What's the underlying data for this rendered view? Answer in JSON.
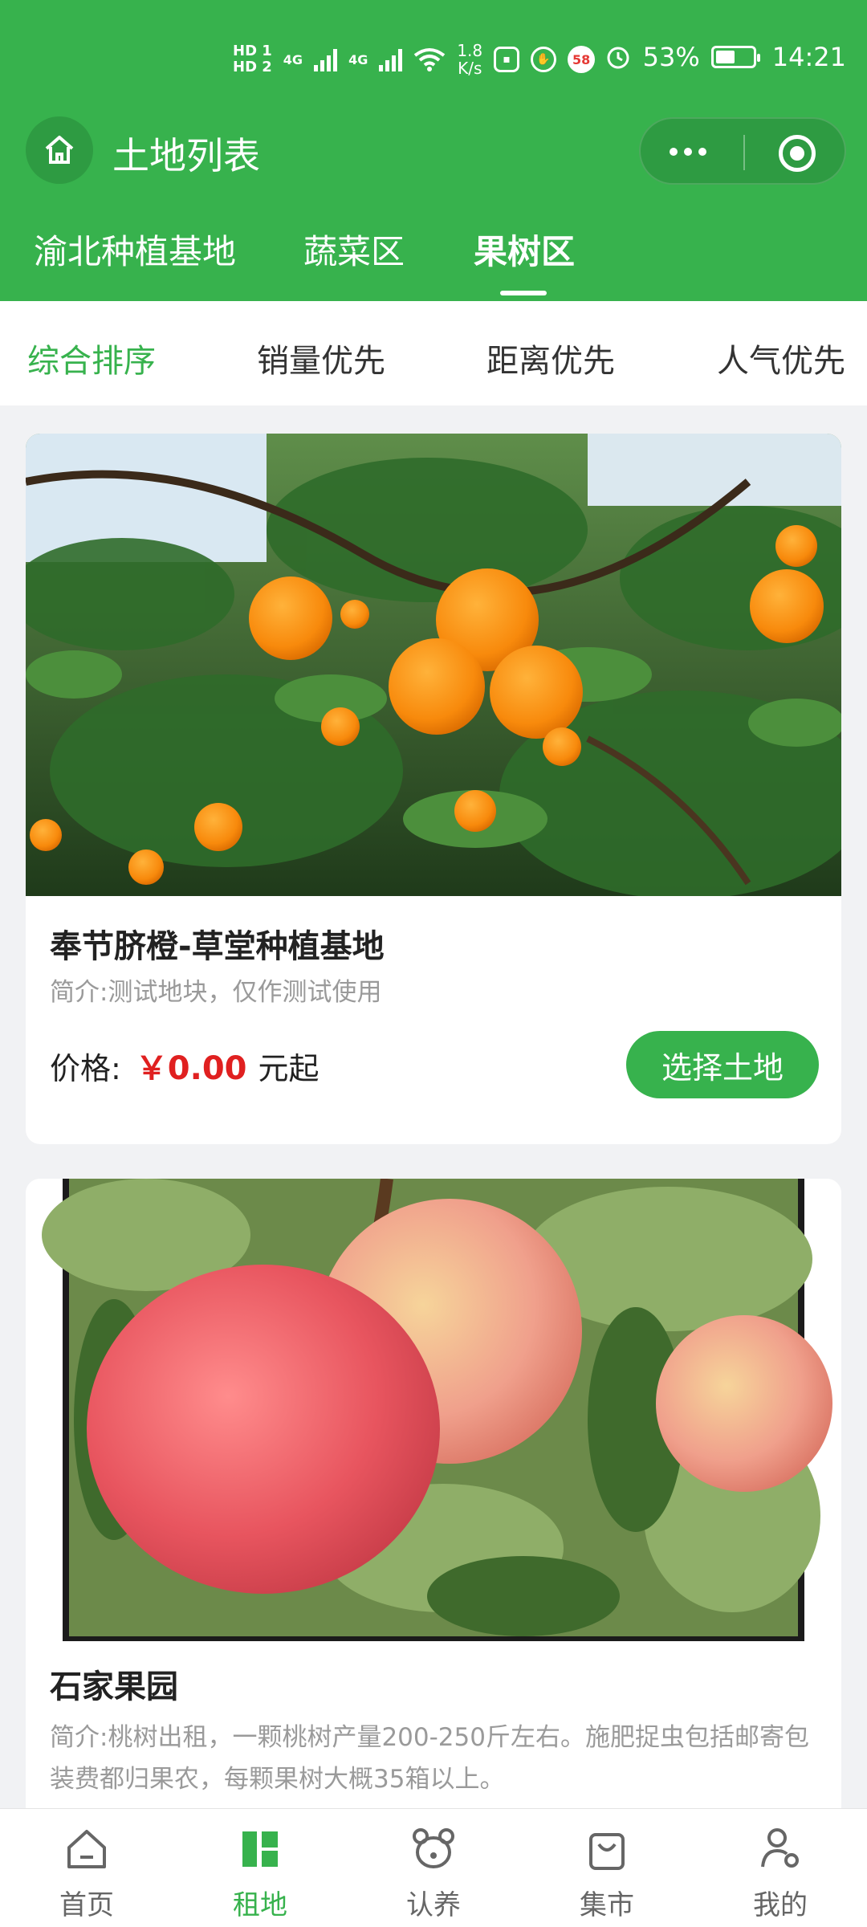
{
  "status_bar": {
    "hd1": "HD 1",
    "hd2": "HD 2",
    "net1": "4G",
    "net2": "4G",
    "speed_value": "1.8",
    "speed_unit": "K/s",
    "badge": "58",
    "battery": "53%",
    "battery_level": 0.53,
    "time": "14:21"
  },
  "navbar": {
    "title": "土地列表"
  },
  "tabs": [
    {
      "label": "渝北种植基地",
      "active": false
    },
    {
      "label": "蔬菜区",
      "active": false
    },
    {
      "label": "果树区",
      "active": true
    }
  ],
  "sort_options": [
    {
      "label": "综合排序",
      "active": true
    },
    {
      "label": "销量优先",
      "active": false
    },
    {
      "label": "距离优先",
      "active": false
    },
    {
      "label": "人气优先",
      "active": false
    }
  ],
  "cards": [
    {
      "title": "奉节脐橙-草堂种植基地",
      "desc": "简介:测试地块，仅作测试使用",
      "price_label": "价格:",
      "price": "￥0.00",
      "price_suffix": "元起",
      "button": "选择土地"
    },
    {
      "title": "石家果园",
      "desc": "简介:桃树出租，一颗桃树产量200-250斤左右。施肥捉虫包括邮寄包装费都归果农，每颗果树大概35箱以上。"
    }
  ],
  "tabbar": [
    {
      "label": "首页",
      "icon": "home-icon",
      "active": false
    },
    {
      "label": "租地",
      "icon": "grid-icon",
      "active": true
    },
    {
      "label": "认养",
      "icon": "bear-icon",
      "active": false
    },
    {
      "label": "集市",
      "icon": "bag-icon",
      "active": false
    },
    {
      "label": "我的",
      "icon": "user-icon",
      "active": false
    }
  ],
  "colors": {
    "primary": "#37b24d",
    "price": "#e02020"
  }
}
